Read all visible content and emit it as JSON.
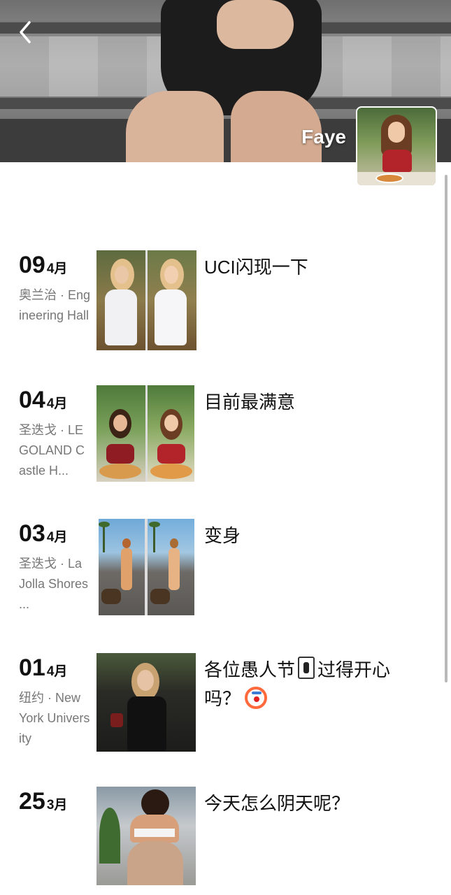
{
  "profile": {
    "nickname": "Faye"
  },
  "posts": [
    {
      "day": "09",
      "month": "4月",
      "location": "奥兰治 · Engineering Hall",
      "caption": "UCI闪现一下",
      "image_layout": "two-photo-split"
    },
    {
      "day": "04",
      "month": "4月",
      "location": "圣迭戈 · LEGOLAND Castle H...",
      "caption": "目前最满意",
      "image_layout": "two-photo-split"
    },
    {
      "day": "03",
      "month": "4月",
      "location": "圣迭戈 · La Jolla Shores ...",
      "caption": "变身",
      "image_layout": "two-photo-split"
    },
    {
      "day": "01",
      "month": "4月",
      "location": "纽约 · New York University",
      "caption_line1": "各位愚人节",
      "caption_line2": "过得开心",
      "caption_line3": "吗？",
      "caption_emoji_1": "joker-card-emoji",
      "caption_emoji_2": "clown-face-emoji",
      "image_layout": "single-photo"
    },
    {
      "day": "25",
      "month": "3月",
      "location": "",
      "caption": "今天怎么阴天呢？",
      "image_layout": "single-photo"
    }
  ],
  "icons": {
    "back": "chevron-left-icon"
  },
  "colors": {
    "location_text": "#777777",
    "date_text": "#111111",
    "nickname_text": "#ffffff"
  }
}
